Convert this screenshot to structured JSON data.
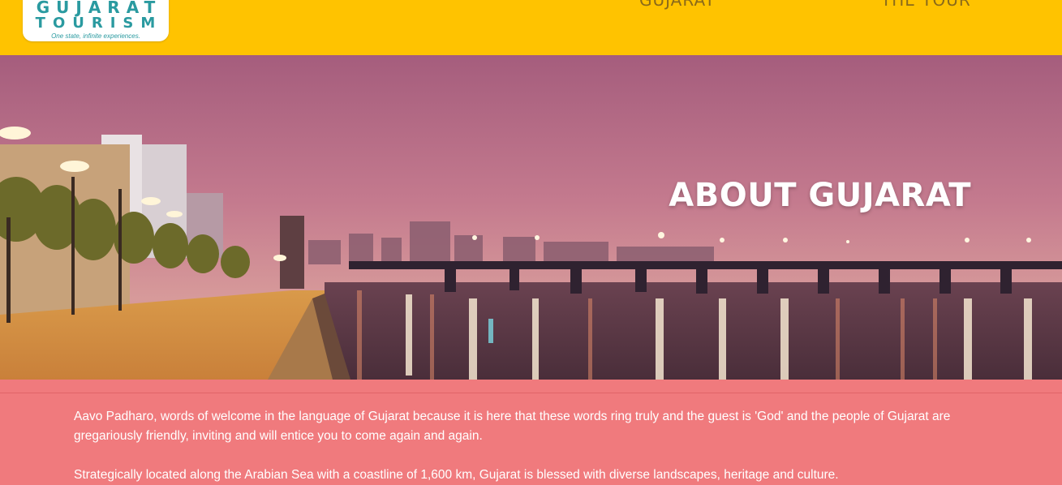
{
  "brand": {
    "name_line1": "GUJARAT",
    "name_line2": "TOURISM",
    "tagline": "One state, infinite experiences."
  },
  "nav": {
    "items": [
      {
        "label": "GUJARAT"
      },
      {
        "label": "THE TOUR"
      }
    ]
  },
  "hero": {
    "title": "ABOUT GUJARAT"
  },
  "content": {
    "paragraphs": [
      "Aavo Padharo, words of welcome in the language of Gujarat because it is here that these words ring truly and the guest is 'God' and the people of Gujarat are gregariously friendly, inviting and will entice you to come again and again.",
      "Strategically located along the Arabian Sea with a coastline of 1,600 km, Gujarat is blessed with diverse landscapes, heritage and culture."
    ]
  },
  "colors": {
    "header_bg": "#ffc300",
    "content_bg": "#f07a7d",
    "logo_teal": "#2a9aa0"
  }
}
